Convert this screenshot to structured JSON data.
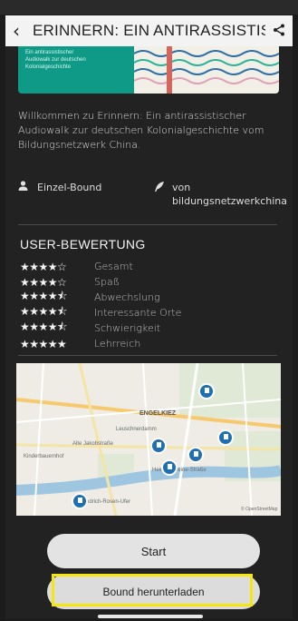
{
  "header": {
    "back_icon": "chevron-left-icon",
    "title": "ERINNERN: EIN ANTIRASSISTIS",
    "share_icon": "share-icon"
  },
  "banner": {
    "text": "Ein antirassistischer Audiowalk zur deutschen Kolonialgeschichte"
  },
  "description": "Willkommen zu Erinnern: Ein antirassistischer Audiowalk zur deutschen Kolonialgeschichte vom Bildungsnetzwerk China.",
  "meta": {
    "type_label": "Einzel-Bound",
    "author_label": "von bildungsnetzwerkchina"
  },
  "ratings": {
    "title": "USER-BEWERTUNG",
    "items": [
      {
        "stars": "★★★★☆",
        "label": "Gesamt"
      },
      {
        "stars": "★★★★☆",
        "label": "Spaß"
      },
      {
        "stars": "★★★★⯪",
        "label": "Abwechslung"
      },
      {
        "stars": "★★★★⯪",
        "label": "Interessante Orte"
      },
      {
        "stars": "★★★★⯪",
        "label": "Schwierigkeit"
      },
      {
        "stars": "★★★★★",
        "label": "Lehrreich"
      }
    ]
  },
  "map": {
    "district_label": "ENGELKIEZ",
    "labels": [
      "Kinderbauernhof",
      "Alte Jakobstraße",
      "Heinrich-Heine-Straße",
      "Leuschnerdamm",
      "Friedrich-Rosen-Ufer",
      "© OpenStreetMap"
    ]
  },
  "buttons": {
    "start": "Start",
    "download": "Bound herunterladen"
  },
  "colors": {
    "background": "#222222",
    "highlight": "#f5e60e",
    "pin": "#1f6fb3"
  }
}
